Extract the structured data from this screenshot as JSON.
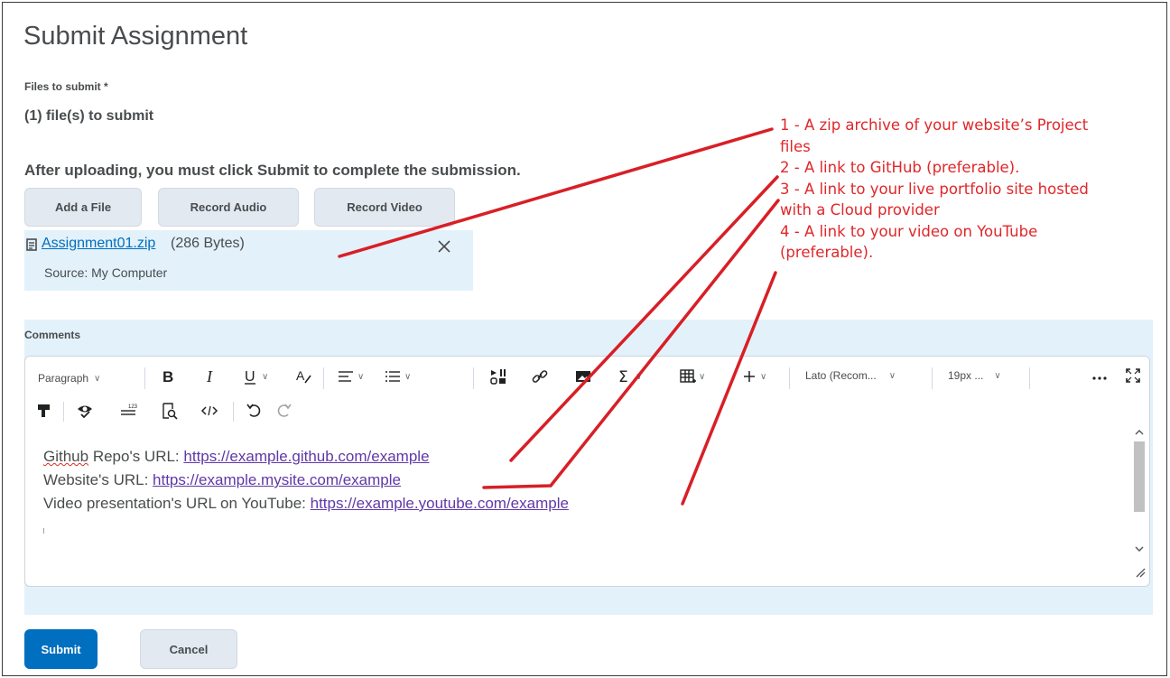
{
  "page": {
    "title": "Submit Assignment",
    "files_label": "Files to submit *",
    "files_count": "(1) file(s) to submit",
    "upload_instructions": "After uploading, you must click Submit to complete the submission."
  },
  "upload_buttons": {
    "add_file": "Add a File",
    "record_audio": "Record Audio",
    "record_video": "Record Video"
  },
  "file": {
    "name": "Assignment01.zip",
    "size": "(286 Bytes)",
    "source": "Source: My Computer"
  },
  "comments": {
    "label": "Comments",
    "toolbar": {
      "paragraph": "Paragraph",
      "font": "Lato (Recom...",
      "size": "19px ..."
    },
    "lines": [
      {
        "label_word": "Github",
        "label_rest": " Repo's URL: ",
        "url": "https://example.github.com/example"
      },
      {
        "label": "Website's URL: ",
        "url": "https://example.mysite.com/example"
      },
      {
        "label": "Video presentation's URL on YouTube: ",
        "url": "https://example.youtube.com/example"
      }
    ]
  },
  "actions": {
    "submit": "Submit",
    "cancel": "Cancel"
  },
  "annotation": {
    "item1a": "1 - A zip archive of your website’s Project",
    "item1b": "files",
    "item2": "2 - A link to GitHub (preferable).",
    "item3a": "3 - A link to your live portfolio site hosted",
    "item3b": "with a Cloud provider",
    "item4a": "4 - A link to your video on YouTube",
    "item4b": "(preferable)."
  },
  "colors": {
    "primary": "#006fbf",
    "annotation": "#e0272a",
    "link_visited": "#6038a8",
    "panel": "#e3f1fa"
  }
}
